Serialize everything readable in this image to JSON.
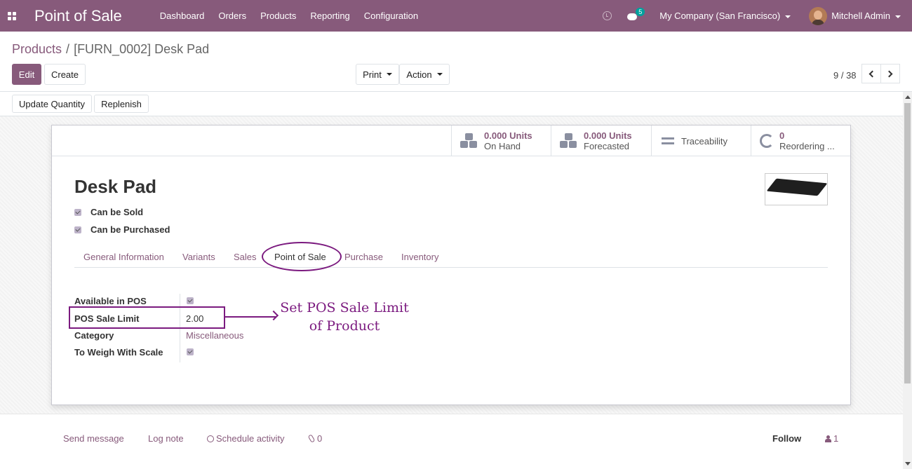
{
  "app": {
    "title": "Point of Sale"
  },
  "nav": {
    "menu": [
      "Dashboard",
      "Orders",
      "Products",
      "Reporting",
      "Configuration"
    ],
    "chat_count": "5",
    "company": "My Company (San Francisco)",
    "user": "Mitchell Admin"
  },
  "breadcrumb": {
    "parent": "Products",
    "separator": "/",
    "current": "[FURN_0002] Desk Pad"
  },
  "toolbar": {
    "edit": "Edit",
    "create": "Create",
    "print": "Print",
    "action": "Action",
    "pager": "9 / 38"
  },
  "statusbar": {
    "update_quantity": "Update Quantity",
    "replenish": "Replenish"
  },
  "smart_buttons": {
    "on_hand_value": "0.000 Units",
    "on_hand_label": "On Hand",
    "forecasted_value": "0.000 Units",
    "forecasted_label": "Forecasted",
    "traceability": "Traceability",
    "reordering_value": "0",
    "reordering_label": "Reordering ..."
  },
  "product": {
    "name": "Desk Pad",
    "can_be_sold": "Can be Sold",
    "can_be_purchased": "Can be Purchased"
  },
  "tabs": [
    "General Information",
    "Variants",
    "Sales",
    "Point of Sale",
    "Purchase",
    "Inventory"
  ],
  "pos_fields": {
    "available_label": "Available in POS",
    "limit_label": "POS Sale Limit",
    "limit_value": "2.00",
    "category_label": "Category",
    "category_value": "Miscellaneous",
    "scale_label": "To Weigh With Scale"
  },
  "annotation": {
    "line1": "Set POS Sale Limit",
    "line2": "of Product"
  },
  "chatter": {
    "send_message": "Send message",
    "log_note": "Log note",
    "schedule_activity": "Schedule activity",
    "attachments": "0",
    "follow": "Follow",
    "followers": "1"
  },
  "colors": {
    "brand": "#875a7b",
    "annotation": "#7b1a7f",
    "badge": "#00a09d"
  }
}
